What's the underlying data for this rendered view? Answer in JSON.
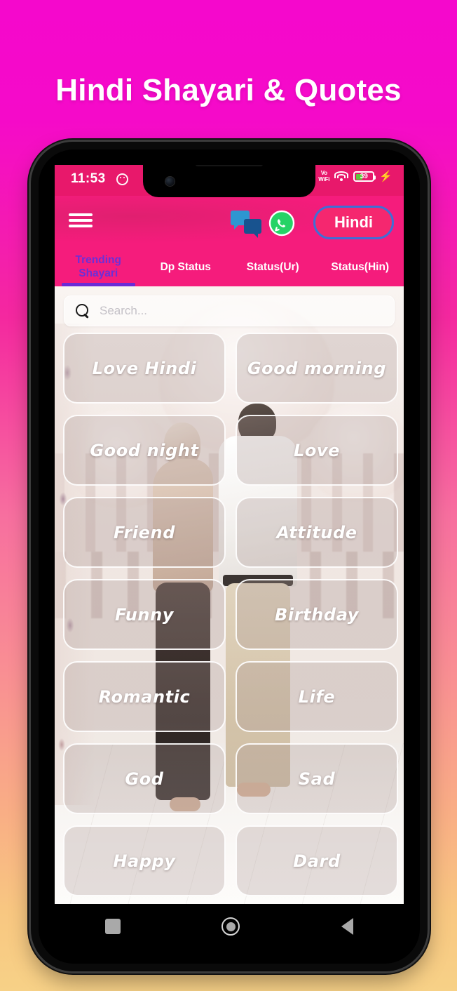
{
  "promo": {
    "title": "Hindi Shayari & Quotes"
  },
  "status_bar": {
    "time": "11:53",
    "smiley_icon": "smiley-face-icon",
    "signal_icon": "cellular-signal-icon",
    "vowifi_line1": "Vo",
    "vowifi_line2": "WiFi",
    "wifi_icon": "wifi-icon",
    "battery_percent": "39",
    "charging_icon": "⚡"
  },
  "header": {
    "menu_icon": "hamburger-menu-icon",
    "chat_icon": "chat-bubbles-icon",
    "whatsapp_icon": "whatsapp-icon",
    "language_label": "Hindi",
    "language_border_color": "#3e6fd6",
    "background_color": "#f51c7c"
  },
  "tabs": {
    "active_color": "#6c2fd8",
    "items": [
      {
        "label": "Trending Shayari",
        "active": true
      },
      {
        "label": "Dp Status",
        "active": false
      },
      {
        "label": "Status(Ur)",
        "active": false
      },
      {
        "label": "Status(Hin)",
        "active": false
      }
    ]
  },
  "search": {
    "icon": "search-icon",
    "placeholder": "Search...",
    "value": ""
  },
  "categories": [
    {
      "label": "Love Hindi"
    },
    {
      "label": "Good morning"
    },
    {
      "label": "Good night"
    },
    {
      "label": "Love"
    },
    {
      "label": "Friend"
    },
    {
      "label": "Attitude"
    },
    {
      "label": "Funny"
    },
    {
      "label": "Birthday"
    },
    {
      "label": "Romantic"
    },
    {
      "label": "Life"
    },
    {
      "label": "God"
    },
    {
      "label": "Sad"
    },
    {
      "label": "Happy"
    },
    {
      "label": "Dard"
    }
  ],
  "navbar": {
    "recents_icon": "recents-square-icon",
    "home_icon": "home-circle-icon",
    "back_icon": "back-triangle-icon"
  }
}
